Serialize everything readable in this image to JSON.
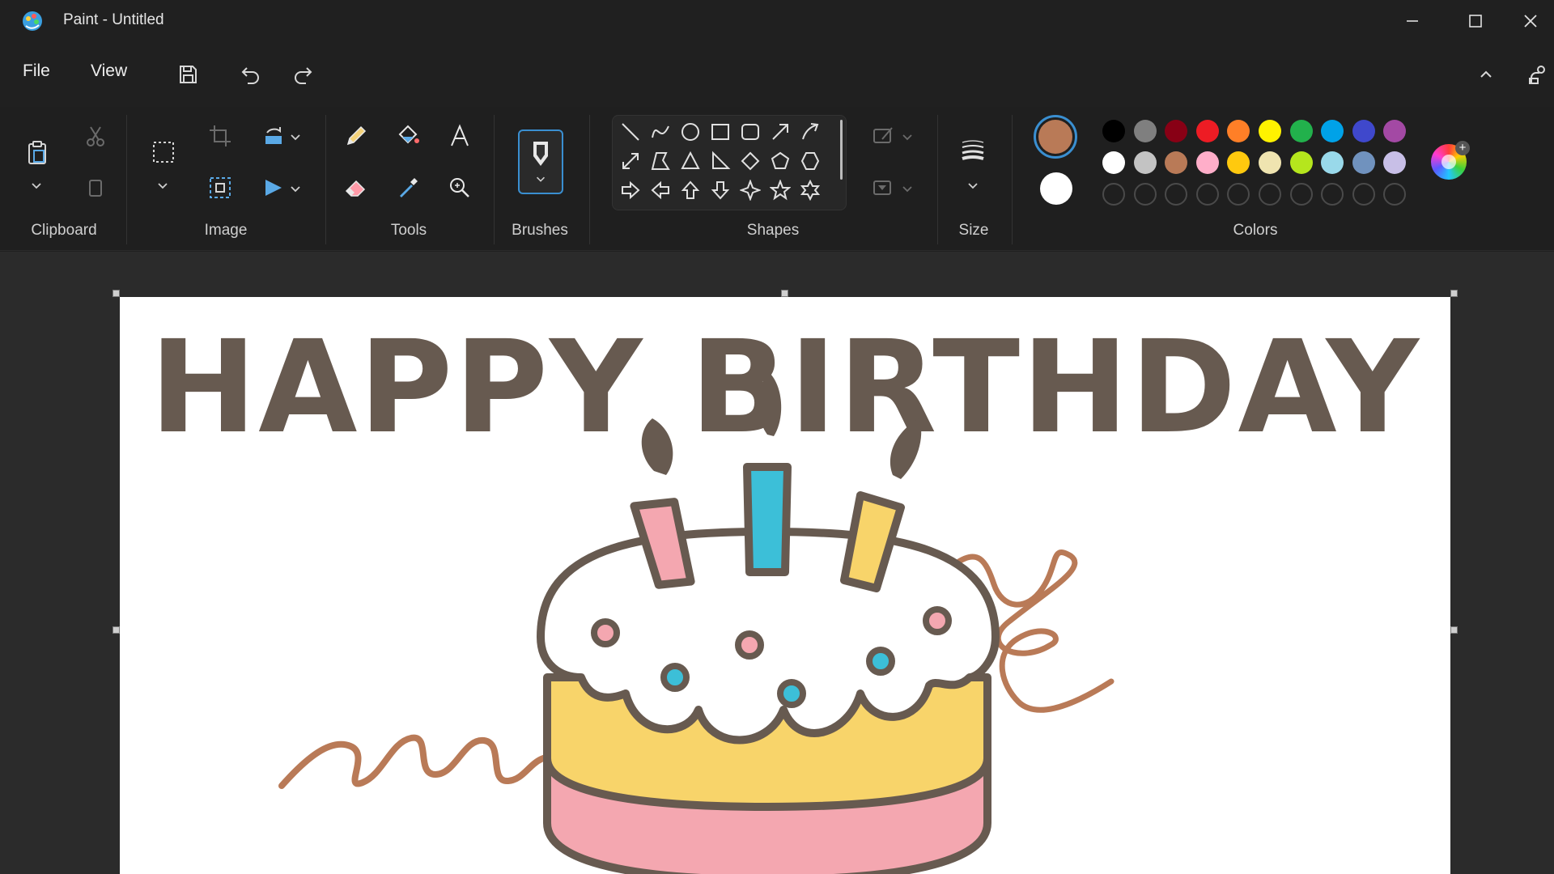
{
  "window": {
    "title": "Paint - Untitled"
  },
  "menu": {
    "file": "File",
    "view": "View"
  },
  "ribbon": {
    "groups": {
      "clipboard": "Clipboard",
      "image": "Image",
      "tools": "Tools",
      "brushes": "Brushes",
      "shapes": "Shapes",
      "size": "Size",
      "colors": "Colors"
    }
  },
  "colors": {
    "current_primary": "#b97a57",
    "current_secondary": "#ffffff",
    "palette_row1": [
      "#000000",
      "#7f7f7f",
      "#880015",
      "#ed1c24",
      "#ff7f27",
      "#fff200",
      "#22b14c",
      "#00a2e8",
      "#3f48cc",
      "#a349a4"
    ],
    "palette_row2": [
      "#ffffff",
      "#c3c3c3",
      "#b97a57",
      "#ffaec9",
      "#ffc90e",
      "#efe4b0",
      "#b5e61d",
      "#99d9ea",
      "#7092be",
      "#c8bfe7"
    ],
    "custom_slots": 10
  },
  "canvas": {
    "text": "HAPPY BIRTHDAY",
    "text_color": "#675a50",
    "drawing": "birthday cake with three candles and brown scribbles"
  }
}
